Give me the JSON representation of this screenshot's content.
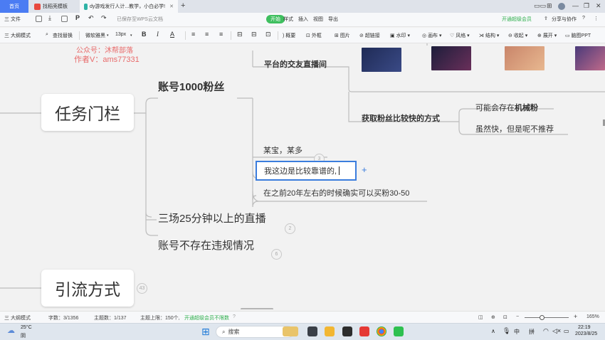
{
  "titlebar": {
    "tabs": [
      {
        "label": "首页"
      },
      {
        "label": "找稻壳模板"
      },
      {
        "label": "dy游戏发行人计...教学，小白必学!"
      }
    ],
    "new_tab": "+"
  },
  "menubar": {
    "file": "三 文件",
    "saved_status": "已保存至WPS云文档",
    "start": "开始",
    "style": "样式",
    "insert": "插入",
    "view": "视图",
    "export": "导出",
    "vip": "开通超级会员",
    "share": "分享与协作",
    "help": "?"
  },
  "toolbar": {
    "outline_mode": "三 大纲模式",
    "find_replace": "查找替换",
    "font": "微软雅黑",
    "font_size": "13px",
    "bold": "B",
    "italic": "I",
    "color": "A",
    "summary": "概要",
    "frame": "外框",
    "image": "图片",
    "link": "超链接",
    "watermark": "水印",
    "canvas": "画布",
    "theme": "风格",
    "structure": "结构",
    "collapse": "收起",
    "expand": "展开",
    "to_ppt": "脑图PPT"
  },
  "mindmap": {
    "watermark_line1": "公众号：沐帮部落",
    "watermark_line2": "作者V：ams77331",
    "root1": "任务门栏",
    "root2": "引流方式",
    "root2_badge": "43",
    "branch_account": "账号1000粉丝",
    "branch_live": "三场25分钟以上的直播",
    "branch_live_badge": "2",
    "branch_violation": "账号不存在违规情况",
    "branch_violation_badge": "6",
    "live_platform": "平台的交友直播间",
    "fast_fans": "获取粉丝比较快的方式",
    "mech_prefix": "可能会存在",
    "mech_bold": "机械粉",
    "not_recommended": "虽然快，但是呢不推荐",
    "some_treasure": "某宝，某多",
    "treasure_badge": "3",
    "editing_text": "我这边是比较靠谱的,",
    "add_plus": "+",
    "buy_fans": "在之前20年左右的时候确实可以买粉30-50"
  },
  "statusbar": {
    "outline_mode": "三 大纲模式",
    "word_count": "字数：3/1356",
    "topic_count": "主题数：1/137",
    "topic_limit": "主题上限：150个,",
    "vip_unlimited": "开通超级会员不限数",
    "zoom_minus": "−",
    "zoom_plus": "+",
    "zoom": "165%",
    "zoom_level_pct": 40
  },
  "taskbar": {
    "temperature": "25°C",
    "weather": "阴",
    "search": "搜索",
    "ime_zh": "中",
    "ime_pinyin": "拼",
    "time": "22:19",
    "date": "2023/8/25",
    "caret_up": "∧"
  }
}
